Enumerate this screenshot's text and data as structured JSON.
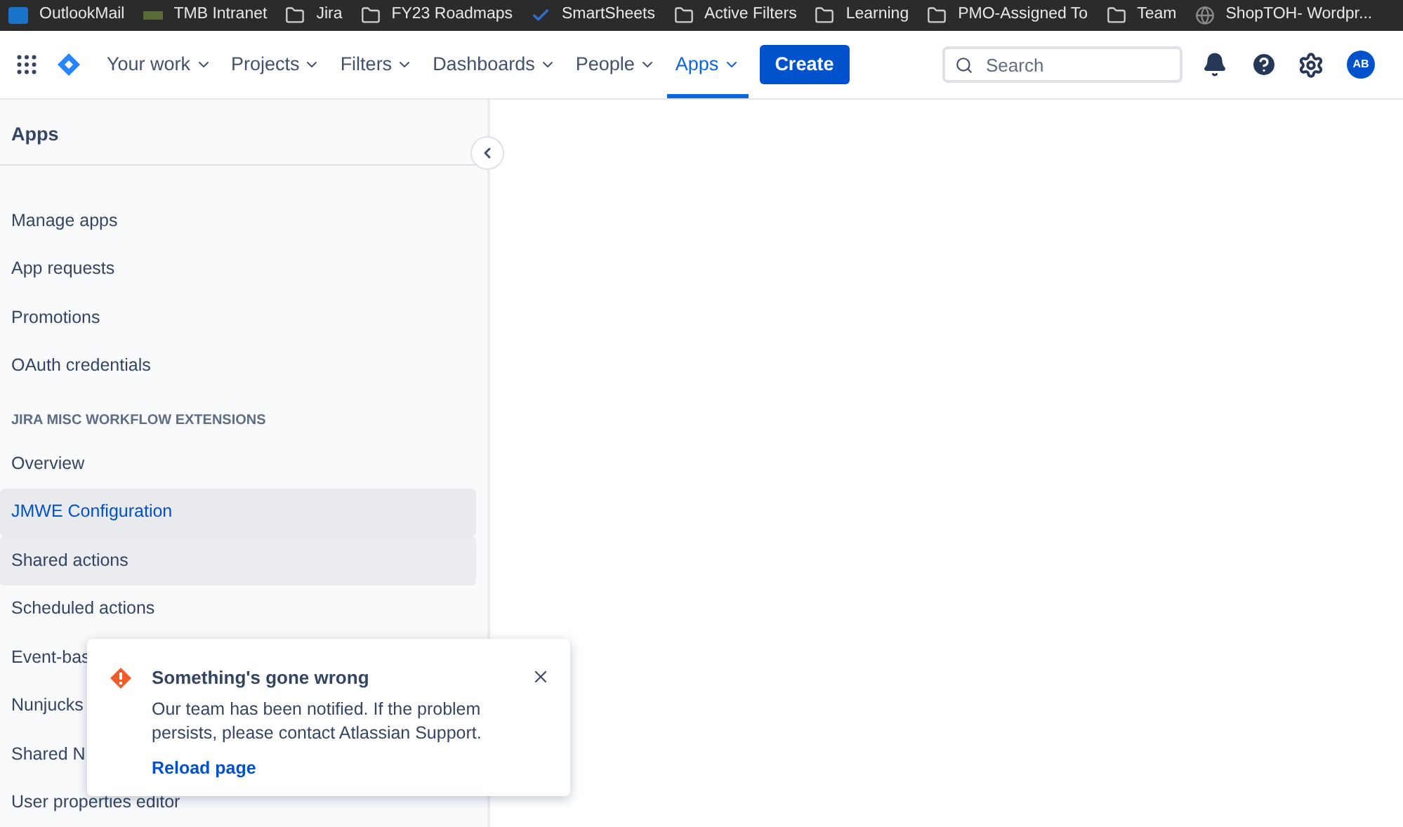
{
  "bookmarks": [
    {
      "label": "OutlookMail",
      "kind": "outlook"
    },
    {
      "label": "TMB Intranet",
      "kind": "tmb"
    },
    {
      "label": "Jira",
      "kind": "folder"
    },
    {
      "label": "FY23 Roadmaps",
      "kind": "folder"
    },
    {
      "label": "SmartSheets",
      "kind": "check"
    },
    {
      "label": "Active Filters",
      "kind": "folder"
    },
    {
      "label": "Learning",
      "kind": "folder"
    },
    {
      "label": "PMO-Assigned To",
      "kind": "folder"
    },
    {
      "label": "Team",
      "kind": "folder"
    },
    {
      "label": "ShopTOH- Wordpr...",
      "kind": "globe"
    }
  ],
  "nav": {
    "items": [
      {
        "label": "Your work",
        "selected": false
      },
      {
        "label": "Projects",
        "selected": false
      },
      {
        "label": "Filters",
        "selected": false
      },
      {
        "label": "Dashboards",
        "selected": false
      },
      {
        "label": "People",
        "selected": false
      },
      {
        "label": "Apps",
        "selected": true
      }
    ],
    "create": "Create",
    "search": {
      "placeholder": "Search"
    },
    "avatar": "AB"
  },
  "sidebar": {
    "title": "Apps",
    "groups": [
      {
        "items": [
          {
            "label": "Manage apps",
            "selected": false,
            "hovered": false
          },
          {
            "label": "App requests",
            "selected": false,
            "hovered": false
          },
          {
            "label": "Promotions",
            "selected": false,
            "hovered": false
          },
          {
            "label": "OAuth credentials",
            "selected": false,
            "hovered": false
          }
        ]
      },
      {
        "heading": "JIRA MISC WORKFLOW EXTENSIONS",
        "items": [
          {
            "label": "Overview",
            "selected": false,
            "hovered": false
          },
          {
            "label": "JMWE Configuration",
            "selected": true,
            "hovered": false
          },
          {
            "label": "Shared actions",
            "selected": false,
            "hovered": true
          },
          {
            "label": "Scheduled actions",
            "selected": false,
            "hovered": false
          },
          {
            "label": "Event-bas",
            "selected": false,
            "hovered": false
          },
          {
            "label": "Nunjucks",
            "selected": false,
            "hovered": false
          },
          {
            "label": "Shared N",
            "selected": false,
            "hovered": false
          },
          {
            "label": "User properties editor",
            "selected": false,
            "hovered": false
          }
        ]
      }
    ]
  },
  "toast": {
    "title": "Something's gone wrong",
    "message": "Our team has been notified. If the problem persists, please contact Atlassian Support.",
    "action": "Reload page"
  }
}
